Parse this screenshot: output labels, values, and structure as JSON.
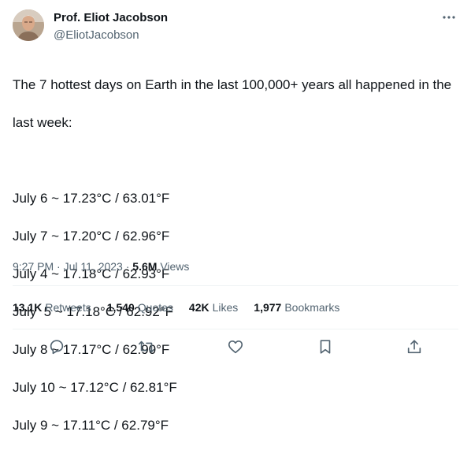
{
  "author": {
    "name": "Prof. Eliot Jacobson",
    "handle": "@EliotJacobson"
  },
  "tweet": {
    "intro_line1": "The 7 hottest days on Earth in the last 100,000+ years all happened in the",
    "intro_line2": "last week:",
    "days": [
      "July 6 ~ 17.23°C / 63.01°F",
      "July 7 ~ 17.20°C / 62.96°F",
      "July 4 ~ 17.18°C / 62.93°F",
      "July  5 ~ 17.18°C / 62.92°F",
      "July 8 ~ 17.17°C / 62.90°F",
      "July 10 ~ 17.12°C / 62.81°F",
      "July 9 ~ 17.11°C / 62.79°F"
    ]
  },
  "meta": {
    "time": "9:27 PM",
    "date": "Jul 11, 2023",
    "views_count": "5.6M",
    "views_label": "Views",
    "separator": " · "
  },
  "stats": {
    "retweets_count": "13.1K",
    "retweets_label": "Retweets",
    "quotes_count": "1,540",
    "quotes_label": "Quotes",
    "likes_count": "42K",
    "likes_label": "Likes",
    "bookmarks_count": "1,977",
    "bookmarks_label": "Bookmarks"
  },
  "icons": {
    "more": "more-dots-icon",
    "reply": "reply-icon",
    "retweet": "retweet-icon",
    "like": "heart-icon",
    "bookmark": "bookmark-icon",
    "share": "share-icon"
  },
  "colors": {
    "text": "#0f1419",
    "secondary": "#536471",
    "divider": "#eff3f4"
  }
}
